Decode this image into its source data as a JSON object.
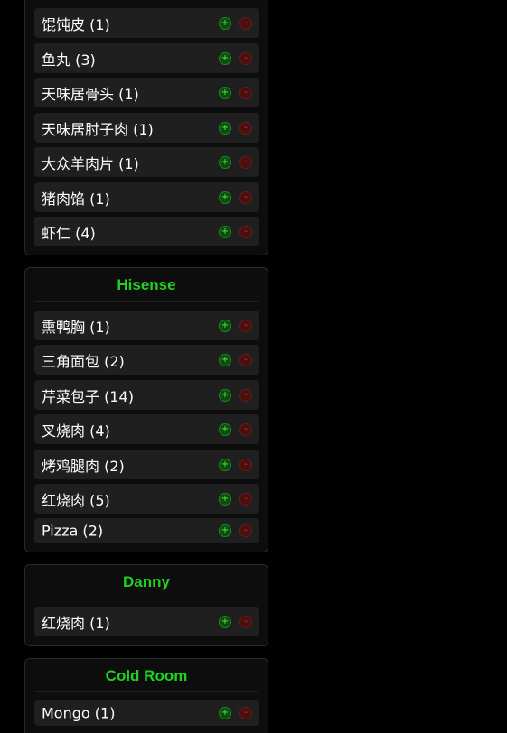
{
  "panels": [
    {
      "title": "",
      "items": [
        {
          "label": "馄饨皮 (1)"
        },
        {
          "label": "鱼丸 (3)"
        },
        {
          "label": "天味居骨头 (1)"
        },
        {
          "label": "天味居肘子肉 (1)"
        },
        {
          "label": "大众羊肉片 (1)"
        },
        {
          "label": "猪肉馅 (1)"
        },
        {
          "label": "虾仁 (4)"
        }
      ]
    },
    {
      "title": "Hisense",
      "items": [
        {
          "label": "熏鸭胸 (1)"
        },
        {
          "label": "三角面包 (2)"
        },
        {
          "label": "芹菜包子 (14)"
        },
        {
          "label": "叉烧肉 (4)"
        },
        {
          "label": "烤鸡腿肉 (2)"
        },
        {
          "label": "红烧肉 (5)"
        },
        {
          "label": "Pizza (2)"
        }
      ]
    },
    {
      "title": "Danny",
      "items": [
        {
          "label": "红烧肉 (1)"
        }
      ]
    },
    {
      "title": "Cold Room",
      "items": [
        {
          "label": "Mongo (1)"
        }
      ]
    }
  ],
  "buttons": {
    "add_symbol": "+",
    "remove_symbol": "-"
  },
  "colors": {
    "background": "#000000",
    "panel_bg": "#0d0d0d",
    "item_bg": "#1f1f1f",
    "title_green": "#1ed21e",
    "add_green": "#0b4d0b",
    "remove_red": "#4a0f0f"
  }
}
